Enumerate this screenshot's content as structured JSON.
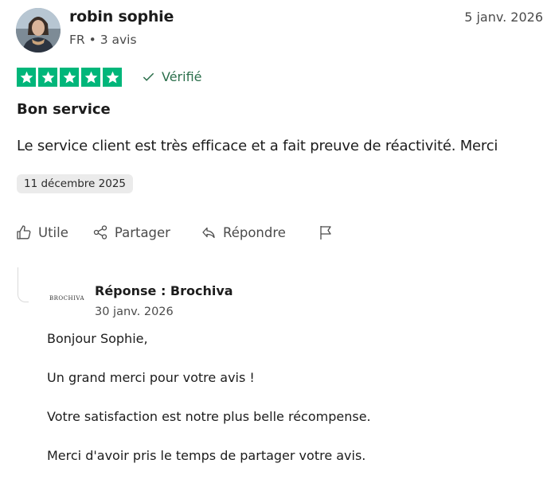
{
  "reviewer": {
    "name": "robin sophie",
    "country": "FR",
    "separator": "•",
    "review_count": "3 avis"
  },
  "review": {
    "date": "5 janv. 2026",
    "rating": 5,
    "verified_label": "Vérifié",
    "title": "Bon service",
    "body": "Le service client est très efficace et a fait preuve de réactivité. Merci",
    "experience_date": "11 décembre 2025"
  },
  "actions": {
    "useful": "Utile",
    "share": "Partager",
    "reply": "Répondre"
  },
  "reply": {
    "logo_text": "BROCHIVA",
    "header": "Réponse : Brochiva",
    "date": "30 janv. 2026",
    "paragraphs": [
      "Bonjour Sophie,",
      "Un grand merci pour votre avis !",
      "Votre satisfaction est notre plus belle récompense.",
      "Merci d'avoir pris le temps de partager votre avis."
    ]
  },
  "colors": {
    "star_green": "#00b67a",
    "verified_green": "#2b6f4b",
    "text_primary": "#1c1c1c",
    "text_secondary": "#4b4b4b",
    "badge_bg": "#ebebeb"
  },
  "icons": [
    "avatar",
    "star-icon",
    "check-icon",
    "thumbs-up-icon",
    "share-icon",
    "reply-arrow-icon",
    "flag-icon"
  ]
}
